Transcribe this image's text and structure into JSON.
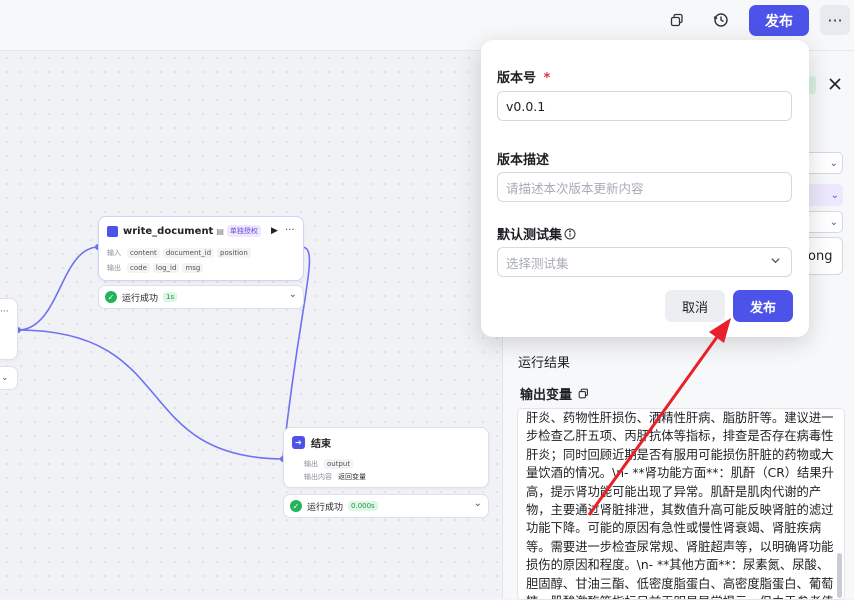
{
  "header": {
    "publish_label": "发布",
    "more_label": "···"
  },
  "canvas": {
    "write_node": {
      "title": "write_document",
      "badge": "单独授权",
      "input_label": "输入",
      "inputs": [
        "content",
        "document_id",
        "position"
      ],
      "output_label": "输出",
      "outputs": [
        "code",
        "log_id",
        "msg"
      ],
      "status": "运行成功",
      "time": "1s"
    },
    "end_node": {
      "title": "结束",
      "output_label": "输出",
      "output_var": "output",
      "output_content_label": "输出内容",
      "output_content_value": "返回变量",
      "status": "运行成功",
      "time": "0.000s"
    },
    "left_node": {
      "more": "···"
    }
  },
  "panel": {
    "run_result_title": "运行结果",
    "output_var_title": "输出变量",
    "partial_text": "ong",
    "result_text": "肝炎、药物性肝损伤、酒精性肝病、脂肪肝等。建议进一步检查乙肝五项、丙肝抗体等指标，排查是否存在病毒性肝炎；同时回顾近期是否有服用可能损伤肝脏的药物或大量饮酒的情况。\\n- **肾功能方面**：肌酐（CR）结果升高，提示肾功能可能出现了异常。肌酐是肌肉代谢的产物，主要通过肾脏排泄，其数值升高可能反映肾脏的滤过功能下降。可能的原因有急性或慢性肾衰竭、肾脏疾病等。需要进一步检查尿常规、肾脏超声等，以明确肾功能损伤的原因和程度。\\n- **其他方面**：尿素氮、尿酸、胆固醇、甘油三酯、低密度脂蛋白、高密度脂蛋白、葡萄糖、肌酸激酶等指标目前无明显异常提示，但由于参考值缺失，不能完全排除潜在的轻微异常情况。建议结合完整"
  },
  "modal": {
    "version_label": "版本号",
    "required_mark": "*",
    "version_value": "v0.0.1",
    "desc_label": "版本描述",
    "desc_placeholder": "请描述本次版本更新内容",
    "testset_label": "默认测试集",
    "testset_placeholder": "选择测试集",
    "cancel_label": "取消",
    "publish_label": "发布"
  },
  "colors": {
    "accent": "#4d53e8",
    "success": "#23b35a",
    "arrow": "#e8202a",
    "edge": "#6d72f0"
  }
}
